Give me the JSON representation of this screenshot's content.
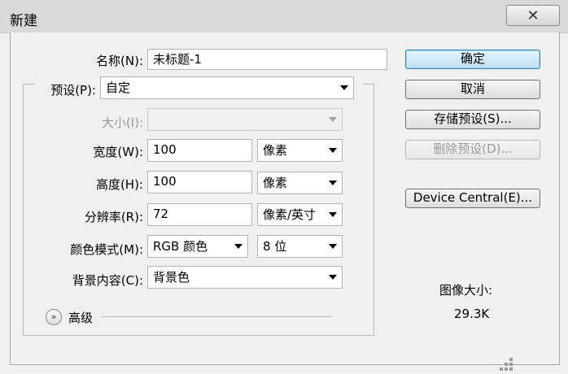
{
  "window": {
    "title": "新建",
    "close_glyph": "✕"
  },
  "form": {
    "name_label": "名称(N):",
    "name_value": "未标题-1",
    "preset_label": "预设(P):",
    "preset_value": "自定",
    "size_label": "大小(I):",
    "size_value": "",
    "width_label": "宽度(W):",
    "width_value": "100",
    "width_unit": "像素",
    "height_label": "高度(H):",
    "height_value": "100",
    "height_unit": "像素",
    "resolution_label": "分辨率(R):",
    "resolution_value": "72",
    "resolution_unit": "像素/英寸",
    "color_mode_label": "颜色模式(M):",
    "color_mode_value": "RGB 颜色",
    "bit_depth_value": "8 位",
    "background_label": "背景内容(C):",
    "background_value": "背景色",
    "advanced_label": "高级",
    "advanced_icon": "»"
  },
  "buttons": {
    "ok": "确定",
    "cancel": "取消",
    "save_preset": "存储预设(S)...",
    "delete_preset": "删除预设(D)...",
    "device_central": "Device Central(E)..."
  },
  "info": {
    "image_size_label": "图像大小:",
    "image_size_value": "29.3K"
  },
  "icons": {
    "close": "close-icon",
    "dropdown": "chevron-down-icon",
    "advanced": "double-chevron-down-icon"
  }
}
